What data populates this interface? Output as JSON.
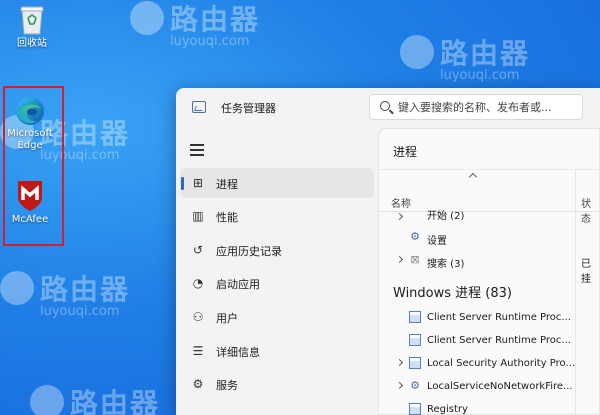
{
  "desktop": {
    "icons": [
      {
        "label": "回收站"
      },
      {
        "label": "Microsoft Edge"
      },
      {
        "label": "McAfee"
      }
    ],
    "watermark": {
      "cn": "路由器",
      "en": "luyouqi.com"
    }
  },
  "window": {
    "title": "任务管理器",
    "search_placeholder": "键入要搜索的名称、发布者或..."
  },
  "nav": {
    "items": [
      {
        "label": "进程",
        "icon": "processes-icon",
        "active": true
      },
      {
        "label": "性能",
        "icon": "performance-icon"
      },
      {
        "label": "应用历史记录",
        "icon": "app-history-icon"
      },
      {
        "label": "启动应用",
        "icon": "startup-apps-icon"
      },
      {
        "label": "用户",
        "icon": "users-icon"
      },
      {
        "label": "详细信息",
        "icon": "details-icon"
      },
      {
        "label": "服务",
        "icon": "services-icon"
      }
    ]
  },
  "content": {
    "title": "进程",
    "columns": {
      "name": "名称",
      "status": "状态"
    },
    "rows_top": [
      {
        "label": "开始 (2)",
        "expandable": true
      },
      {
        "label": "设置",
        "expandable": false
      },
      {
        "label": "搜索 (3)",
        "expandable": true,
        "status": "已挂"
      }
    ],
    "section": "Windows 进程 (83)",
    "rows_win": [
      {
        "label": "Client Server Runtime Proc...",
        "expandable": false
      },
      {
        "label": "Client Server Runtime Proc...",
        "expandable": false
      },
      {
        "label": "Local Security Authority Pro...",
        "expandable": true
      },
      {
        "label": "LocalServiceNoNetworkFire...",
        "expandable": true
      },
      {
        "label": "Registry",
        "expandable": false
      }
    ]
  }
}
